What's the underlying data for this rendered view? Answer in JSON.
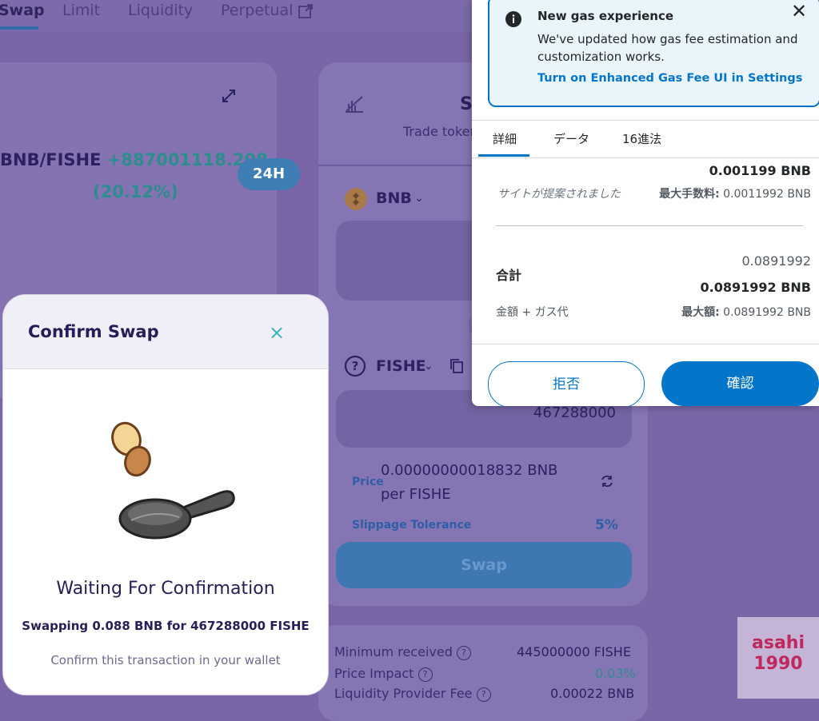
{
  "nav": {
    "tabs": [
      "Swap",
      "Limit",
      "Liquidity",
      "Perpetual"
    ],
    "active": "Swap"
  },
  "chart": {
    "pair": "BNB/FISHE",
    "change": "+887001118.208",
    "change_pct": "(20.12%)",
    "range_button": "24H"
  },
  "swap": {
    "title_partial": "S",
    "subtitle_partial": "Trade token",
    "from_token": "BNB",
    "to_token": "FISHE",
    "to_amount": "467288000",
    "price_label": "Price",
    "price_value_line1": "0.00000000018832 BNB",
    "price_value_line2": "per FISHE",
    "slippage_label": "Slippage Tolerance",
    "slippage_value": "5%",
    "swap_button": "Swap"
  },
  "details": {
    "min_received_label": "Minimum received",
    "min_received_value": "445000000 FISHE",
    "price_impact_label": "Price Impact",
    "price_impact_value": "0.03%",
    "lp_fee_label": "Liquidity Provider Fee",
    "lp_fee_value": "0.00022 BNB"
  },
  "modal": {
    "title": "Confirm Swap",
    "close": "×",
    "waiting": "Waiting For Confirmation",
    "swapping": "Swapping 0.088 BNB for 467288000 FISHE",
    "hint": "Confirm this transaction in your wallet"
  },
  "metamask": {
    "banner_title": "New gas experience",
    "banner_body": "We've updated how gas fee estimation and customization works.",
    "banner_link": "Turn on Enhanced Gas Fee UI in Settings",
    "tabs": [
      "詳細",
      "データ",
      "16進法"
    ],
    "gas_value": "0.001199 BNB",
    "gas_source": "サイトが提案されました",
    "max_fee_label": "最大手数料:",
    "max_fee_value": "0.0011992 BNB",
    "total_label": "合計",
    "total_small": "0.0891992",
    "total_bold": "0.0891992 BNB",
    "total_sub": "金額 + ガス代",
    "max_amount_label": "最大額:",
    "max_amount_value": "0.0891992 BNB",
    "reject": "拒否",
    "confirm": "確認",
    "accent": "#0376c9"
  },
  "watermark": {
    "line1": "asahi",
    "line2": "1990"
  }
}
